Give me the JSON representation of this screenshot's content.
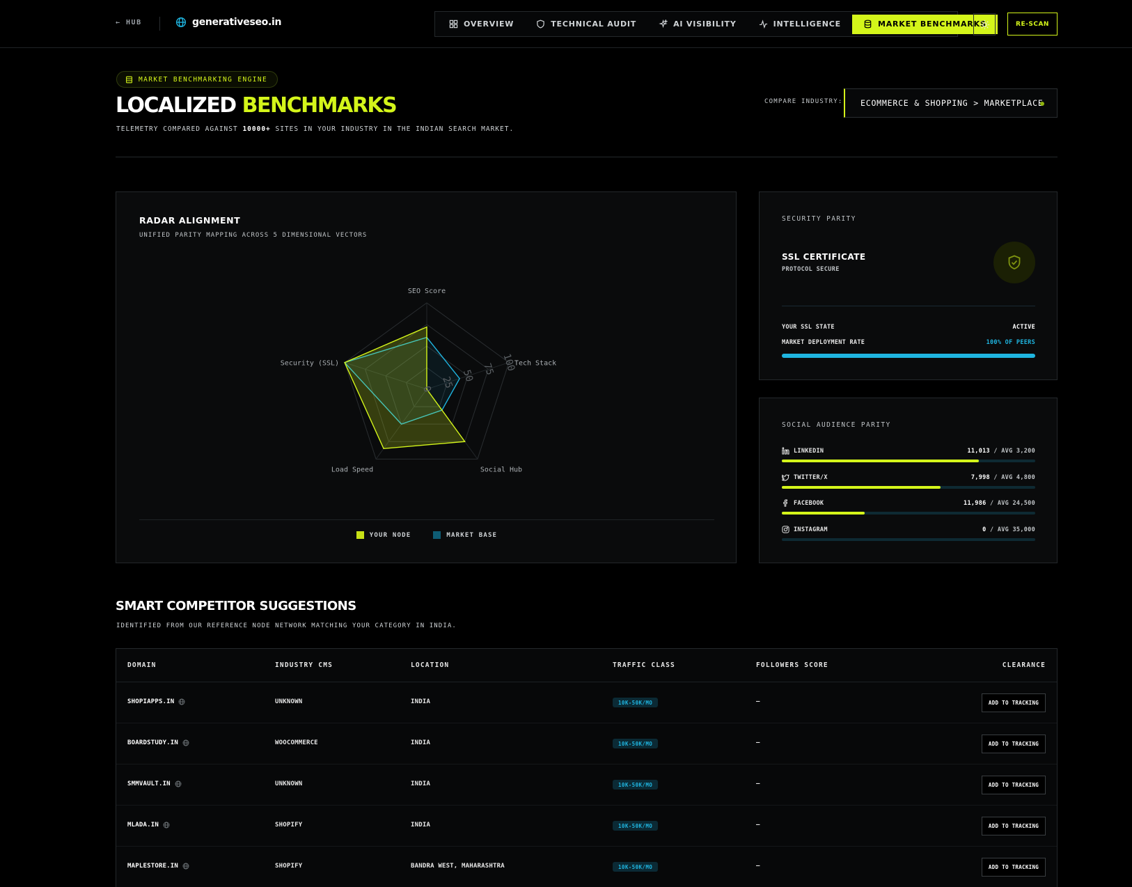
{
  "topbar": {
    "hub_label": "← HUB",
    "brand": "generativeseo.in",
    "nav": [
      {
        "label": "OVERVIEW",
        "icon": "grid-icon"
      },
      {
        "label": "TECHNICAL AUDIT",
        "icon": "shield-icon"
      },
      {
        "label": "AI VISIBILITY",
        "icon": "sparkles-icon"
      },
      {
        "label": "INTELLIGENCE",
        "icon": "activity-icon"
      },
      {
        "label": "MARKET BENCHMARKS",
        "icon": "database-icon",
        "active": true
      }
    ],
    "theme_icon": "sun-icon",
    "rescan_label": "RE-SCAN"
  },
  "hero": {
    "pill": "MARKET BENCHMARKING ENGINE",
    "title_plain": "LOCALIZED ",
    "title_accent": "BENCHMARKS",
    "sub_before": "TELEMETRY COMPARED AGAINST ",
    "sub_bold": "10000+",
    "sub_after": " SITES IN YOUR INDUSTRY IN THE INDIAN SEARCH MARKET.",
    "compare_label": "COMPARE INDUSTRY:",
    "compare_value": "ECOMMERCE & SHOPPING > MARKETPLACE"
  },
  "radar": {
    "title": "RADAR ALIGNMENT",
    "subtitle": "UNIFIED PARITY MAPPING ACROSS 5 DIMENSIONAL VECTORS",
    "legend_your": "YOUR NODE",
    "legend_market": "MARKET BASE"
  },
  "chart_data": {
    "type": "radar",
    "axes": [
      "SEO Score",
      "Tech Stack",
      "Social Hub",
      "Load Speed",
      "Security (SSL)"
    ],
    "rticks": [
      "0",
      "25",
      "50",
      "75",
      "100"
    ],
    "rlim": [
      0,
      100
    ],
    "series": [
      {
        "name": "YOUR NODE",
        "color": "#d4f51a",
        "values": [
          72,
          0,
          75,
          85,
          100
        ]
      },
      {
        "name": "MARKET BASE",
        "color": "#1fb5e0",
        "values": [
          60,
          40,
          30,
          50,
          100
        ]
      }
    ]
  },
  "security": {
    "label": "SECURITY PARITY",
    "ssl_title": "SSL CERTIFICATE",
    "ssl_sub": "PROTOCOL SECURE",
    "state_key": "YOUR SSL STATE",
    "state_val": "ACTIVE",
    "rate_key": "MARKET DEPLOYMENT RATE",
    "rate_val": "100% OF PEERS",
    "rate_fraction": 1.0
  },
  "social": {
    "label": "SOCIAL AUDIENCE PARITY",
    "rows": [
      {
        "name": "LINKEDIN",
        "icon": "linkedin-icon",
        "value": "11,013",
        "avg": "AVG 3,200",
        "fraction": 0.778
      },
      {
        "name": "TWITTER/X",
        "icon": "twitter-icon",
        "value": "7,998",
        "avg": "AVG 4,800",
        "fraction": 0.625
      },
      {
        "name": "FACEBOOK",
        "icon": "facebook-icon",
        "value": "11,986",
        "avg": "AVG 24,500",
        "fraction": 0.328
      },
      {
        "name": "INSTAGRAM",
        "icon": "instagram-icon",
        "value": "0",
        "avg": "AVG 35,000",
        "fraction": 0
      }
    ]
  },
  "competitors": {
    "title": "SMART COMPETITOR SUGGESTIONS",
    "subtitle": "IDENTIFIED FROM OUR REFERENCE NODE NETWORK MATCHING YOUR CATEGORY IN INDIA.",
    "columns": [
      "DOMAIN",
      "INDUSTRY CMS",
      "LOCATION",
      "TRAFFIC CLASS",
      "FOLLOWERS SCORE",
      "CLEARANCE"
    ],
    "action_label": "ADD TO TRACKING",
    "rows": [
      {
        "domain": "SHOPIAPPS.IN",
        "cms": "UNKNOWN",
        "location": "INDIA",
        "traffic": "10K-50K/MO",
        "followers": "—"
      },
      {
        "domain": "BOARDSTUDY.IN",
        "cms": "WOOCOMMERCE",
        "location": "INDIA",
        "traffic": "10K-50K/MO",
        "followers": "—"
      },
      {
        "domain": "SMMVAULT.IN",
        "cms": "UNKNOWN",
        "location": "INDIA",
        "traffic": "10K-50K/MO",
        "followers": "—"
      },
      {
        "domain": "MLADA.IN",
        "cms": "SHOPIFY",
        "location": "INDIA",
        "traffic": "10K-50K/MO",
        "followers": "—"
      },
      {
        "domain": "MAPLESTORE.IN",
        "cms": "SHOPIFY",
        "location": "BANDRA WEST, MAHARASHTRA",
        "traffic": "10K-50K/MO",
        "followers": "—"
      }
    ]
  }
}
